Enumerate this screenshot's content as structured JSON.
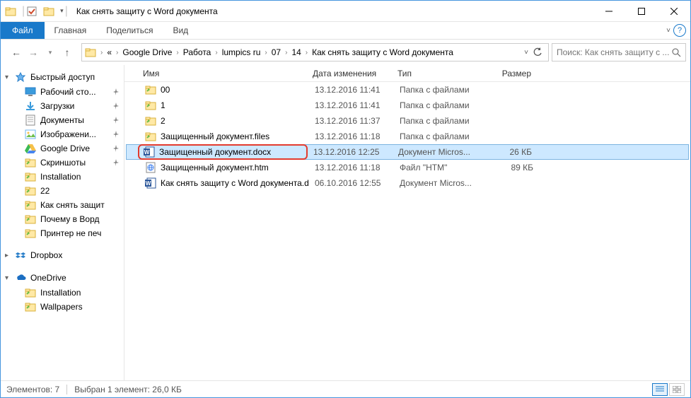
{
  "title": "Как снять защиту с Word документа",
  "ribbon": {
    "file": "Файл",
    "tabs": [
      "Главная",
      "Поделиться",
      "Вид"
    ]
  },
  "breadcrumb": {
    "prefix_ellipsis": "«",
    "items": [
      "Google Drive",
      "Работа",
      "lumpics ru",
      "07",
      "14",
      "Как снять защиту с Word документа"
    ]
  },
  "search": {
    "placeholder": "Поиск: Как снять защиту с ..."
  },
  "sidebar": {
    "quick": {
      "label": "Быстрый доступ",
      "items": [
        {
          "icon": "desktop",
          "label": "Рабочий сто...",
          "pin": true
        },
        {
          "icon": "download",
          "label": "Загрузки",
          "pin": true
        },
        {
          "icon": "doc",
          "label": "Документы",
          "pin": true
        },
        {
          "icon": "image",
          "label": "Изображени...",
          "pin": true
        },
        {
          "icon": "gdrive",
          "label": "Google Drive",
          "pin": true
        },
        {
          "icon": "folder",
          "label": "Скриншоты",
          "pin": true
        },
        {
          "icon": "folder",
          "label": "Installation",
          "pin": false
        },
        {
          "icon": "folder",
          "label": "22",
          "pin": false
        },
        {
          "icon": "folder",
          "label": "Как снять защит",
          "pin": false
        },
        {
          "icon": "folder",
          "label": "Почему в Ворд",
          "pin": false
        },
        {
          "icon": "folder",
          "label": "Принтер не печ",
          "pin": false
        }
      ]
    },
    "dropbox": {
      "label": "Dropbox"
    },
    "onedrive": {
      "label": "OneDrive",
      "items": [
        {
          "icon": "folder",
          "label": "Installation"
        },
        {
          "icon": "folder",
          "label": "Wallpapers"
        }
      ]
    }
  },
  "columns": {
    "name": "Имя",
    "date": "Дата изменения",
    "type": "Тип",
    "size": "Размер"
  },
  "files": [
    {
      "icon": "folder",
      "name": "00",
      "date": "13.12.2016 11:41",
      "type": "Папка с файлами",
      "size": ""
    },
    {
      "icon": "folder",
      "name": "1",
      "date": "13.12.2016 11:41",
      "type": "Папка с файлами",
      "size": ""
    },
    {
      "icon": "folder",
      "name": "2",
      "date": "13.12.2016 11:37",
      "type": "Папка с файлами",
      "size": ""
    },
    {
      "icon": "folder",
      "name": "Защищенный документ.files",
      "date": "13.12.2016 11:18",
      "type": "Папка с файлами",
      "size": ""
    },
    {
      "icon": "word",
      "name": "Защищенный документ.docx",
      "date": "13.12.2016 12:25",
      "type": "Документ Micros...",
      "size": "26 КБ",
      "selected": true,
      "highlight": true
    },
    {
      "icon": "htm",
      "name": "Защищенный документ.htm",
      "date": "13.12.2016 11:18",
      "type": "Файл \"HTM\"",
      "size": "89 КБ"
    },
    {
      "icon": "word",
      "name": "Как снять защиту с Word документа.docx",
      "date": "06.10.2016 12:55",
      "type": "Документ Micros...",
      "size": ""
    }
  ],
  "status": {
    "count_label": "Элементов: 7",
    "selection_label": "Выбран 1 элемент: 26,0 КБ"
  }
}
